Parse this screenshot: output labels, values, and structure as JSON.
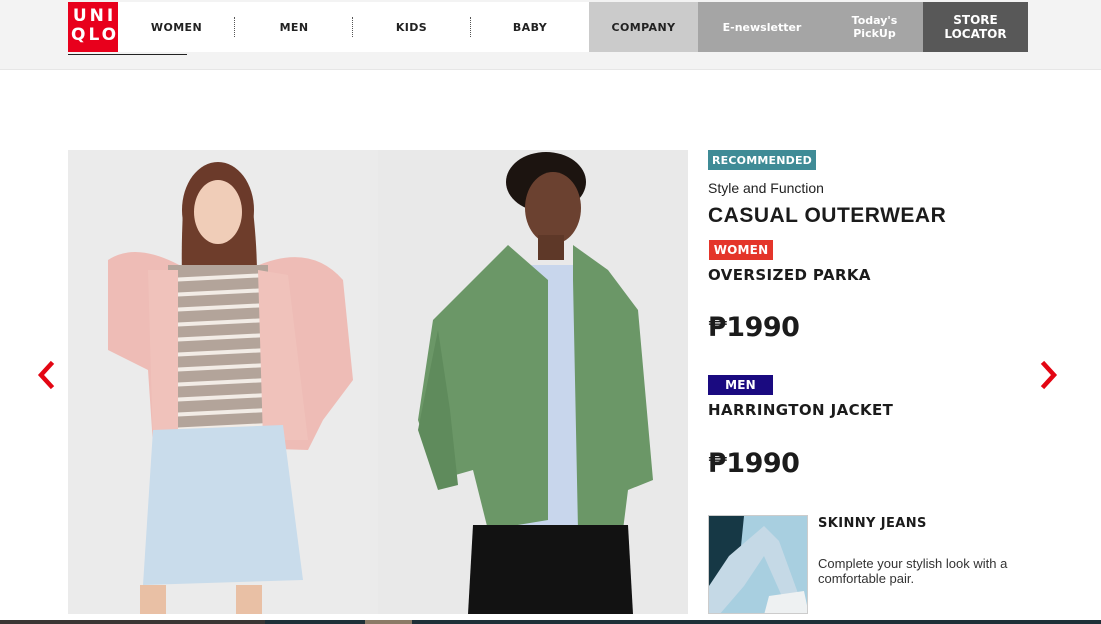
{
  "header": {
    "logo": {
      "line1": "UNI",
      "line2": "QLO"
    },
    "nav": [
      {
        "label": "WOMEN"
      },
      {
        "label": "MEN"
      },
      {
        "label": "KIDS"
      },
      {
        "label": "BABY"
      }
    ],
    "tabs": {
      "company": "COMPANY",
      "enewsletter": "E-newsletter",
      "pickup_line1": "Today's",
      "pickup_line2": "PickUp",
      "store_line1": "STORE",
      "store_line2": "LOCATOR"
    }
  },
  "colors": {
    "brand_red": "#e8001c",
    "recommended_badge": "#3f8b96",
    "women_badge": "#e4352a",
    "men_badge": "#1a0a80",
    "arrow": "#e30613"
  },
  "feature": {
    "badge": "RECOMMENDED",
    "subtitle": "Style and Function",
    "headline": "CASUAL OUTERWEAR",
    "products": [
      {
        "category": "WOMEN",
        "name": "OVERSIZED PARKA",
        "price": "₱1990"
      },
      {
        "category": "MEN",
        "name": "HARRINGTON JACKET",
        "price": "₱1990"
      }
    ],
    "promo": {
      "title": "SKINNY JEANS",
      "description": "Complete your stylish look with a comfortable pair."
    }
  },
  "carousel": {
    "prev_icon": "chevron-left-icon",
    "next_icon": "chevron-right-icon"
  }
}
